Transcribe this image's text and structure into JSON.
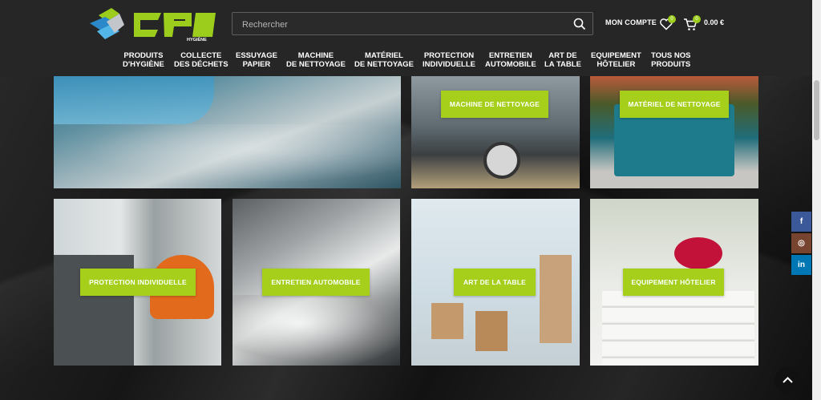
{
  "header": {
    "logo_text": "CPI",
    "logo_sub": "HYGIÈNE",
    "search_placeholder": "Rechercher",
    "account_label": "MON COMPTE",
    "wishlist_count": "0",
    "cart_count": "0",
    "cart_total": "0.00 €"
  },
  "nav": {
    "items": [
      {
        "line1": "PRODUITS",
        "line2": "D'HYGIÈNE"
      },
      {
        "line1": "COLLECTE",
        "line2": "DES DÉCHETS"
      },
      {
        "line1": "ESSUYAGE",
        "line2": "PAPIER"
      },
      {
        "line1": "MACHINE",
        "line2": "DE NETTOYAGE"
      },
      {
        "line1": "MATÉRIEL",
        "line2": "DE NETTOYAGE"
      },
      {
        "line1": "PROTECTION",
        "line2": "INDIVIDUELLE"
      },
      {
        "line1": "ENTRETIEN",
        "line2": "AUTOMOBILE"
      },
      {
        "line1": "ART DE",
        "line2": "LA TABLE"
      },
      {
        "line1": "EQUIPEMENT",
        "line2": "HÔTELIER"
      },
      {
        "line1": "TOUS NOS",
        "line2": "PRODUITS"
      }
    ]
  },
  "tiles": [
    {
      "label": "MACHINE DE NETTOYAGE"
    },
    {
      "label": "MATÉRIEL DE NETTOYAGE"
    },
    {
      "label": "PROTECTION INDIVIDUELLE"
    },
    {
      "label": "ENTRETIEN AUTOMOBILE"
    },
    {
      "label": "ART DE LA TABLE"
    },
    {
      "label": "EQUIPEMENT HÔTELIER"
    }
  ],
  "social": {
    "facebook": "f",
    "instagram": "◎",
    "linkedin": "in"
  },
  "colors": {
    "accent": "#a5cf1a",
    "header_bg": "#262626",
    "facebook": "#3b5998",
    "instagram": "#774430",
    "linkedin": "#0077b5"
  }
}
